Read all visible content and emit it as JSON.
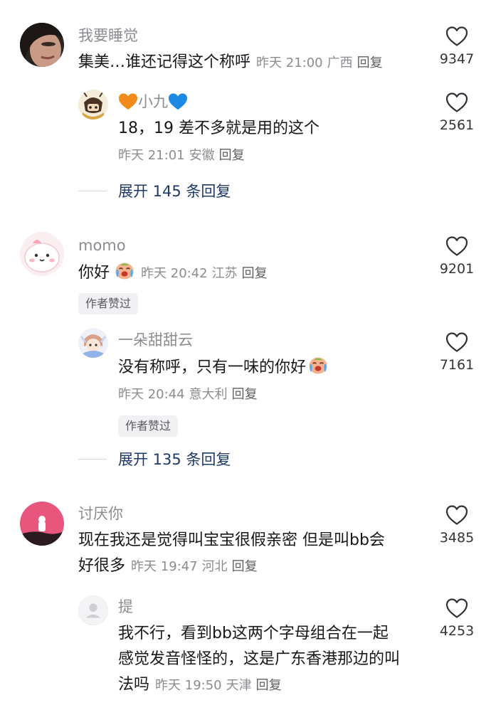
{
  "comments": [
    {
      "username": "我要睡觉",
      "text": "集美…谁还记得这个称呼",
      "time": "昨天 21:00",
      "location": "广西",
      "reply_label": "回复",
      "likes": "9347",
      "replies": [
        {
          "username": "小九",
          "text": "18，19 差不多就是用的这个",
          "time": "昨天 21:01",
          "location": "安徽",
          "reply_label": "回复",
          "likes": "2561"
        }
      ],
      "expand_label": "展开 145 条回复"
    },
    {
      "username": "momo",
      "text": "你好",
      "time": "昨天 20:42",
      "location": "江苏",
      "reply_label": "回复",
      "likes": "9201",
      "badge": "作者赞过",
      "replies": [
        {
          "username": "一朵甜甜云",
          "text": "没有称呼，只有一味的你好",
          "time": "昨天 20:44",
          "location": "意大利",
          "reply_label": "回复",
          "likes": "7161",
          "badge": "作者赞过"
        }
      ],
      "expand_label": "展开 135 条回复"
    },
    {
      "username": "讨厌你",
      "text_line1": "现在我还是觉得叫宝宝很假亲密 但是叫bb会",
      "text_line2": "好很多",
      "time": "昨天 19:47",
      "location": "河北",
      "reply_label": "回复",
      "likes": "3485",
      "replies": [
        {
          "username": "提",
          "text_line1": "我不行，看到bb这两个字母组合在一起",
          "text_line2": "感觉发音怪怪的，这是广东香港那边的叫",
          "text_line3": "法吗",
          "time": "昨天 19:50",
          "location": "天津",
          "reply_label": "回复",
          "likes": "4253"
        }
      ]
    }
  ],
  "icons": {
    "like": "heart-outline-icon",
    "orange_heart": "orange-heart-emoji",
    "blue_heart": "blue-heart-emoji",
    "crying_face": "crying-laughing-emoji"
  },
  "colors": {
    "username": "#8b8c91",
    "body_text": "#17181b",
    "expand_link": "#1f3a6a",
    "badge_bg": "#f1f1f3"
  }
}
